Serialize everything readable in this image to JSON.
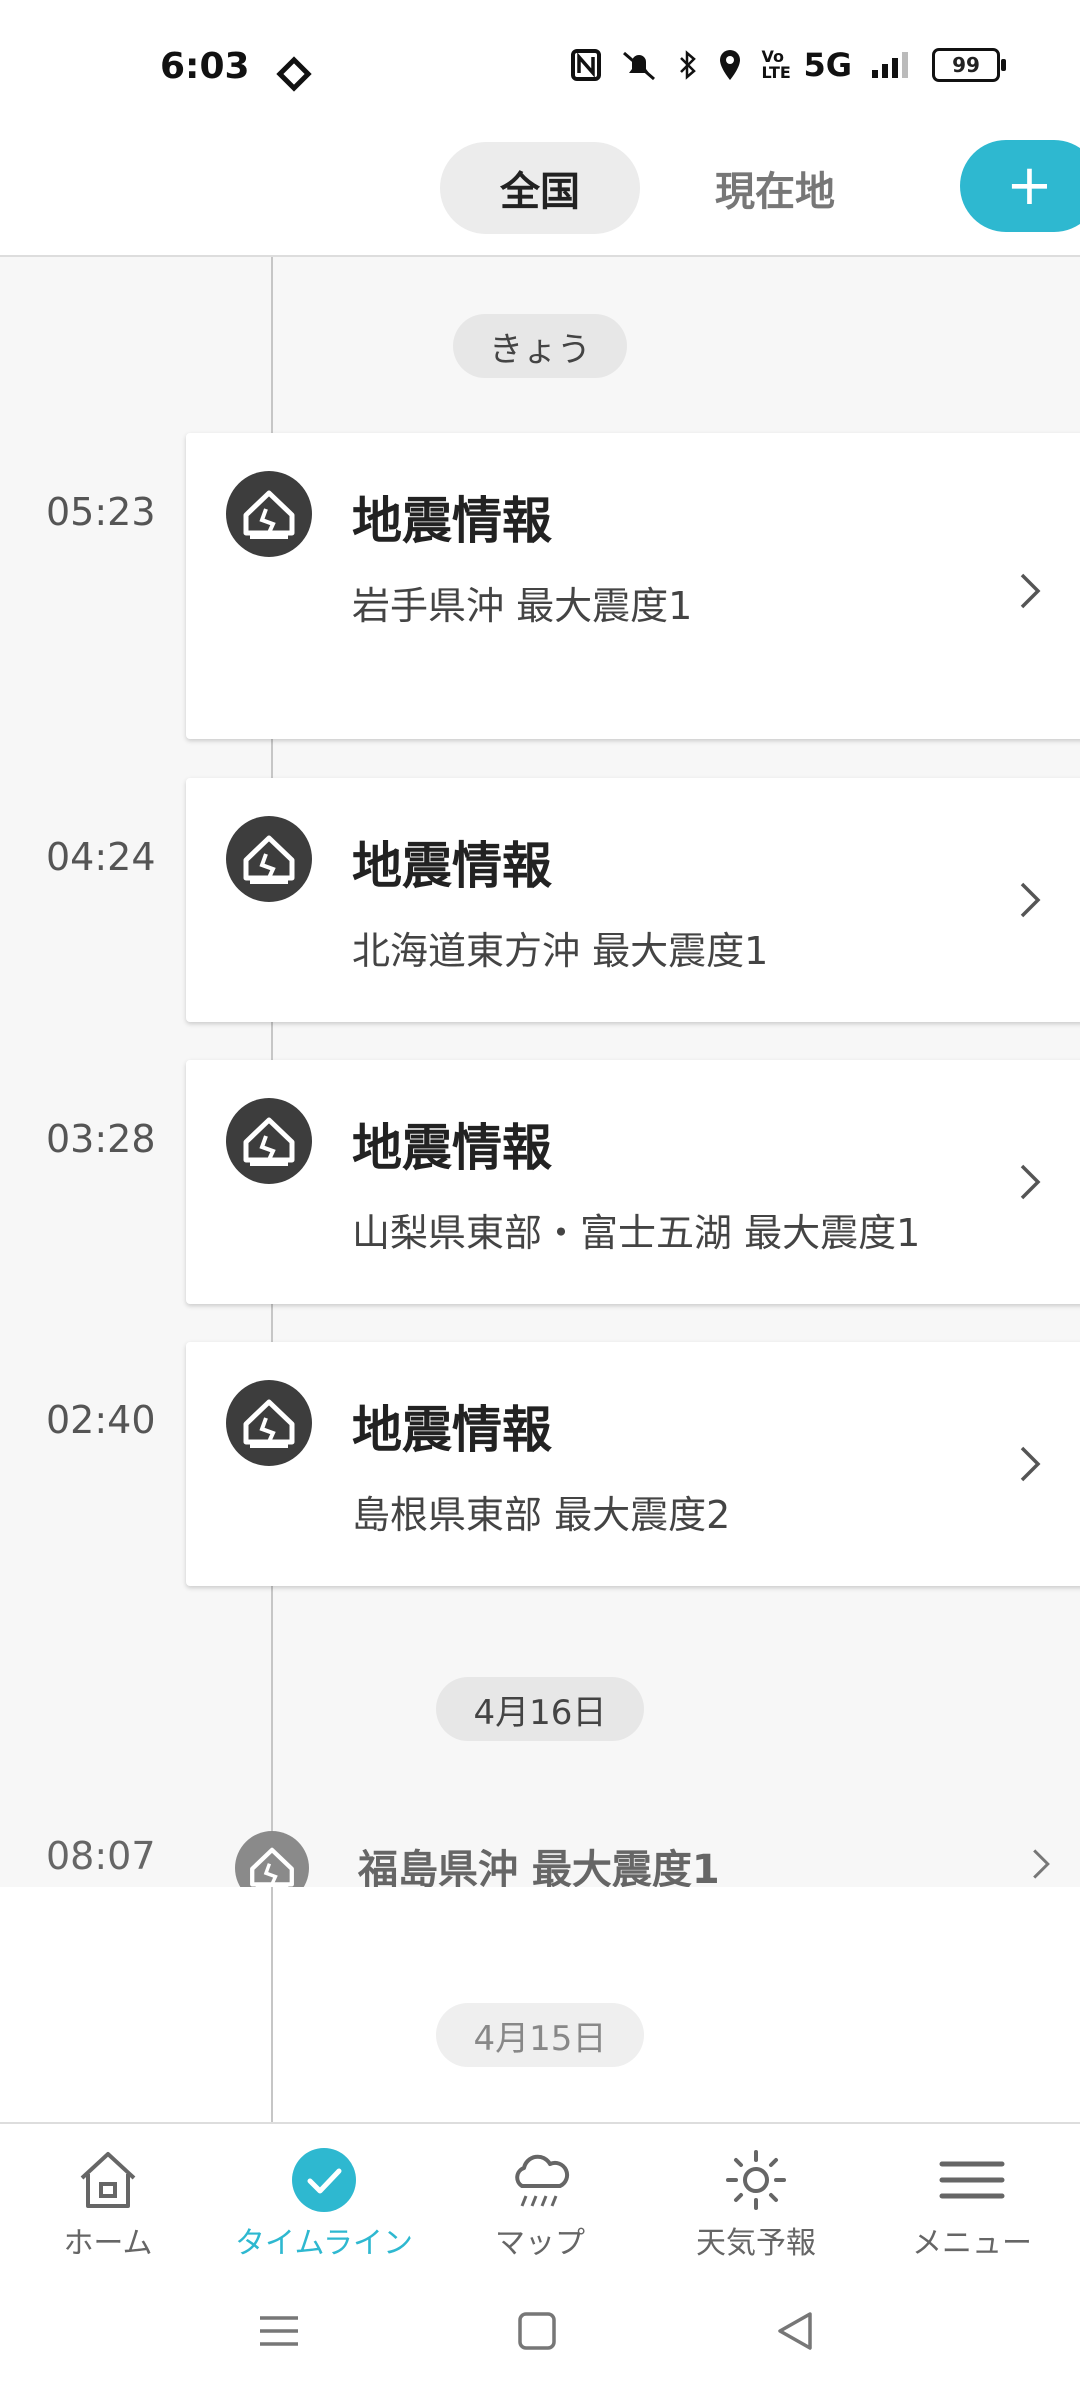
{
  "status_bar": {
    "time": "6:03",
    "network": "5G",
    "volte": "Vo LTE",
    "battery": "99"
  },
  "header": {
    "tabs": [
      "全国",
      "現在地"
    ],
    "add_button": "+"
  },
  "timeline": {
    "sections": [
      {
        "date": "きょう",
        "items": [
          {
            "time": "05:23",
            "title": "地震情報",
            "subtitle": "岩手県沖 最大震度1"
          },
          {
            "time": "04:24",
            "title": "地震情報",
            "subtitle": "北海道東方沖 最大震度1"
          },
          {
            "time": "03:28",
            "title": "地震情報",
            "subtitle": "山梨県東部・富士五湖 最大震度1"
          },
          {
            "time": "02:40",
            "title": "地震情報",
            "subtitle": "島根県東部 最大震度2"
          }
        ]
      },
      {
        "date": "4月16日",
        "items": [
          {
            "time": "08:07",
            "title": "福島県沖 最大震度1"
          }
        ]
      },
      {
        "date": "4月15日",
        "items": []
      }
    ]
  },
  "bottom_nav": {
    "items": [
      {
        "label": "ホーム",
        "icon": "home-icon"
      },
      {
        "label": "タイムライン",
        "icon": "timeline-check-icon"
      },
      {
        "label": "マップ",
        "icon": "rain-cloud-icon"
      },
      {
        "label": "天気予報",
        "icon": "sun-icon"
      },
      {
        "label": "メニュー",
        "icon": "menu-icon"
      }
    ],
    "active_index": 1
  },
  "colors": {
    "accent": "#2eb8d0",
    "icon_dark": "#3d3d3d"
  }
}
